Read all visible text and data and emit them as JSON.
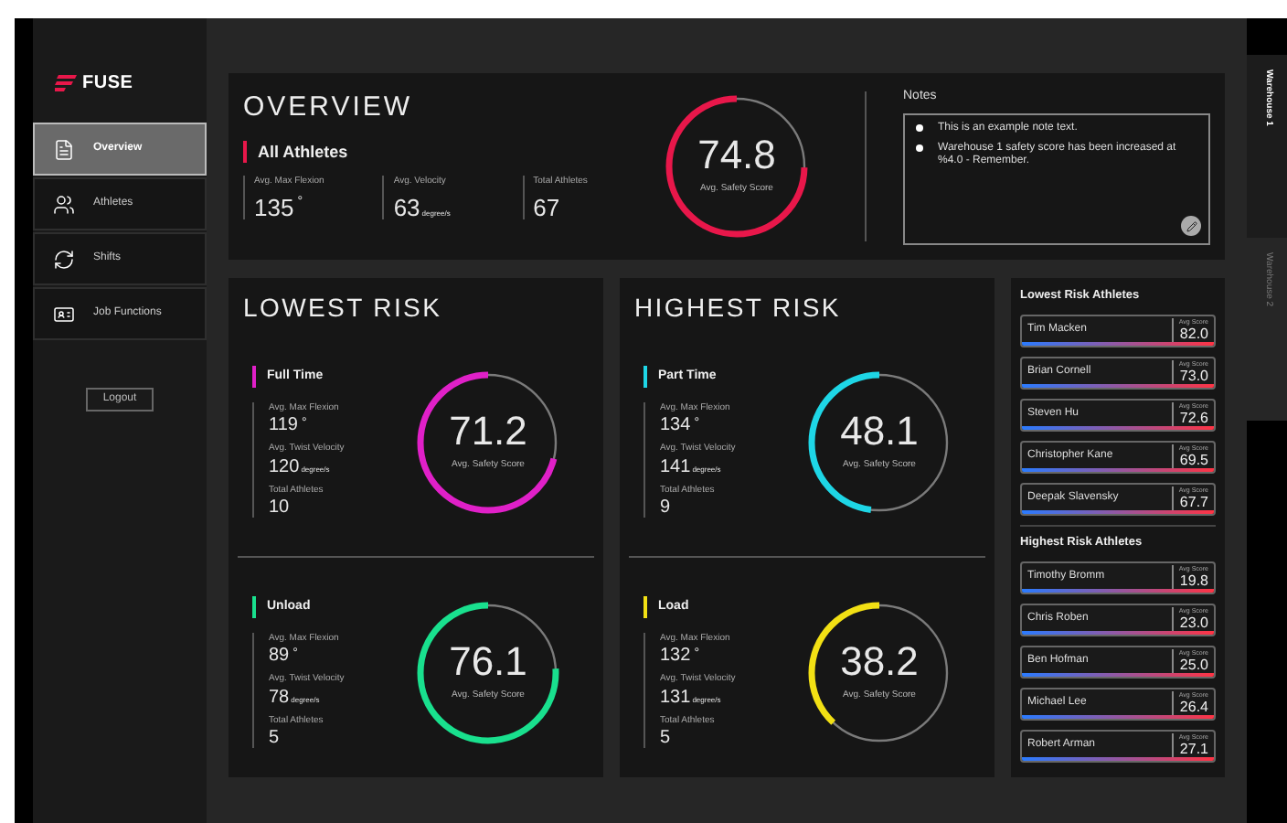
{
  "sidebar": {
    "logo": "FUSE",
    "items": [
      {
        "label": "Overview",
        "selected": true
      },
      {
        "label": "Athletes",
        "selected": false
      },
      {
        "label": "Shifts",
        "selected": false
      },
      {
        "label": "Job Functions",
        "selected": false
      }
    ],
    "logout": "Logout"
  },
  "overview": {
    "title": "OVERVIEW",
    "group": "All Athletes",
    "color": "#e8174a",
    "stats": [
      {
        "label": "Avg. Max Flexion",
        "value": "135",
        "unit": "°"
      },
      {
        "label": "Avg. Velocity",
        "value": "63",
        "unit": "degree/s"
      },
      {
        "label": "Total Athletes",
        "value": "67"
      }
    ],
    "score": {
      "value": "74.8",
      "label": "Avg. Safety Score",
      "level": 0.748
    }
  },
  "notes": {
    "title": "Notes",
    "items": [
      "This is an example note text.",
      "Warehouse 1 safety score has been increased at %4.0 - Remember."
    ]
  },
  "sections": [
    {
      "title": "LOWEST RISK",
      "groups": [
        {
          "name": "Full Time",
          "color": "#e020c8",
          "stats": [
            {
              "label": "Avg. Max Flexion",
              "value": "119",
              "unit": "°"
            },
            {
              "label": "Avg. Twist Velocity",
              "value": "120",
              "unit": "degree/s"
            },
            {
              "label": "Total Athletes",
              "value": "10"
            }
          ],
          "score": {
            "value": "71.2",
            "label": "Avg. Safety Score",
            "level": 0.712
          }
        },
        {
          "name": "Unload",
          "color": "#19e08e",
          "stats": [
            {
              "label": "Avg. Max Flexion",
              "value": "89",
              "unit": "°"
            },
            {
              "label": "Avg. Twist Velocity",
              "value": "78",
              "unit": "degree/s"
            },
            {
              "label": "Total Athletes",
              "value": "5"
            }
          ],
          "score": {
            "value": "76.1",
            "label": "Avg. Safety Score",
            "level": 0.761
          }
        }
      ]
    },
    {
      "title": "HIGHEST RISK",
      "groups": [
        {
          "name": "Part Time",
          "color": "#1ed6e6",
          "stats": [
            {
              "label": "Avg. Max Flexion",
              "value": "134",
              "unit": "°"
            },
            {
              "label": "Avg. Twist Velocity",
              "value": "141",
              "unit": "degree/s"
            },
            {
              "label": "Total Athletes",
              "value": "9"
            }
          ],
          "score": {
            "value": "48.1",
            "label": "Avg. Safety Score",
            "level": 0.481
          }
        },
        {
          "name": "Load",
          "color": "#f2e014",
          "stats": [
            {
              "label": "Avg. Max Flexion",
              "value": "132",
              "unit": "°"
            },
            {
              "label": "Avg. Twist Velocity",
              "value": "131",
              "unit": "degree/s"
            },
            {
              "label": "Total Athletes",
              "value": "5"
            }
          ],
          "score": {
            "value": "38.2",
            "label": "Avg. Safety Score",
            "level": 0.382
          }
        }
      ]
    }
  ],
  "athlete_lists": [
    {
      "title": "Lowest Risk Athletes",
      "athletes": [
        {
          "name": "Tim Macken",
          "score_label": "Avg Score",
          "score": "82.0"
        },
        {
          "name": "Brian Cornell",
          "score_label": "Avg Score",
          "score": "73.0"
        },
        {
          "name": "Steven Hu",
          "score_label": "Avg Score",
          "score": "72.6"
        },
        {
          "name": "Christopher Kane",
          "score_label": "Avg Score",
          "score": "69.5"
        },
        {
          "name": "Deepak Slavensky",
          "score_label": "Avg Score",
          "score": "67.7"
        }
      ]
    },
    {
      "title": "Highest Risk Athletes",
      "athletes": [
        {
          "name": "Timothy Bromm",
          "score_label": "Avg Score",
          "score": "19.8"
        },
        {
          "name": "Chris Roben",
          "score_label": "Avg Score",
          "score": "23.0"
        },
        {
          "name": "Ben Hofman",
          "score_label": "Avg Score",
          "score": "25.0"
        },
        {
          "name": "Michael Lee",
          "score_label": "Avg Score",
          "score": "26.4"
        },
        {
          "name": "Robert Arman",
          "score_label": "Avg Score",
          "score": "27.1"
        }
      ]
    }
  ],
  "tabs": [
    {
      "label": "Warehouse 1",
      "selected": true
    },
    {
      "label": "Warehouse 2",
      "selected": false
    }
  ]
}
